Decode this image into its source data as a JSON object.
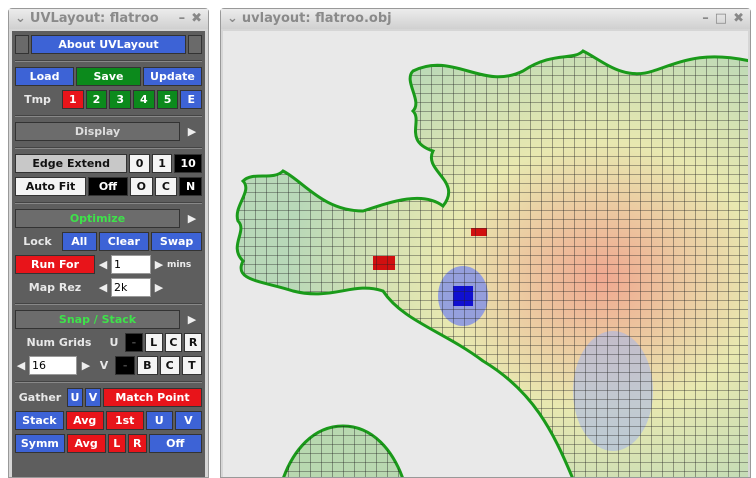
{
  "panel": {
    "title": "UVLayout: flatroo",
    "about": "About UVLayout",
    "file": {
      "load": "Load",
      "save": "Save",
      "update": "Update"
    },
    "tmp": {
      "label": "Tmp",
      "slots": [
        "1",
        "2",
        "3",
        "4",
        "5"
      ],
      "extra": "E"
    },
    "display": "Display",
    "edge_extend": {
      "label": "Edge Extend",
      "opts": [
        "0",
        "1",
        "10"
      ]
    },
    "auto_fit": {
      "label": "Auto Fit",
      "value": "Off",
      "opts": [
        "O",
        "C",
        "N"
      ]
    },
    "optimize": "Optimize",
    "lock": {
      "label": "Lock",
      "all": "All",
      "clear": "Clear",
      "swap": "Swap"
    },
    "run_for": {
      "label": "Run For",
      "value": "1",
      "unit": "mins"
    },
    "map_rez": {
      "label": "Map Rez",
      "value": "2k"
    },
    "snap": "Snap / Stack",
    "num_grids": {
      "label": "Num Grids",
      "u": "U",
      "v": "V",
      "value": "16",
      "u_opts": [
        "-",
        "L",
        "C",
        "R"
      ],
      "v_opts": [
        "-",
        "B",
        "C",
        "T"
      ]
    },
    "gather": {
      "label": "Gather",
      "u": "U",
      "v": "V",
      "match": "Match Point"
    },
    "stack": {
      "label": "Stack",
      "avg": "Avg",
      "first": "1st",
      "u": "U",
      "v": "V"
    },
    "symm": {
      "label": "Symm",
      "avg": "Avg",
      "l": "L",
      "r": "R",
      "off": "Off"
    }
  },
  "viewport": {
    "title": "uvlayout: flatroo.obj",
    "mesh_outline_color": "#1a9a1a"
  }
}
